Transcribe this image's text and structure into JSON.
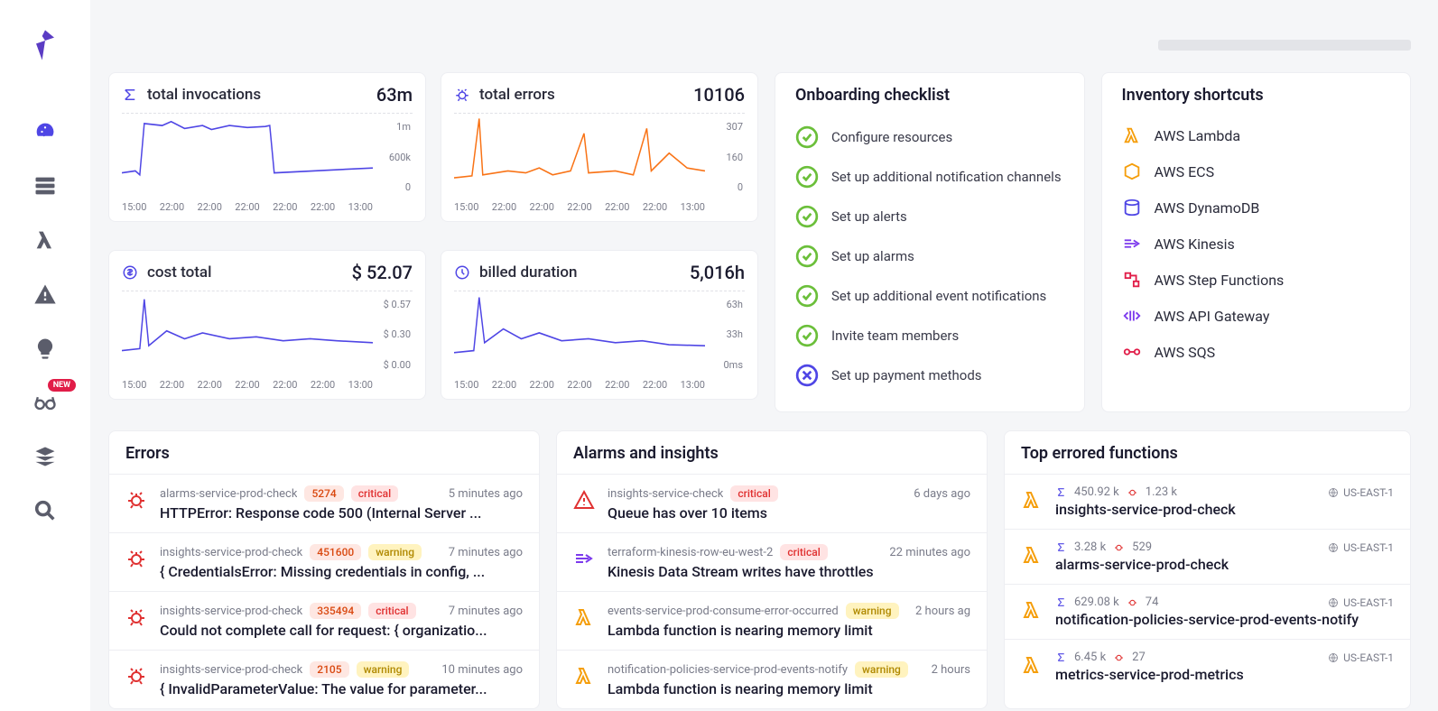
{
  "sidebar": {
    "badge_new": "NEW"
  },
  "metrics": [
    {
      "icon": "sigma",
      "title": "total invocations",
      "value": "63m",
      "ylabels": [
        "1m",
        "600k",
        "0"
      ],
      "xlabels": [
        "15:00",
        "22:00",
        "22:00",
        "22:00",
        "22:00",
        "22:00",
        "13:00"
      ],
      "color": "#4f46e5",
      "series": "inv"
    },
    {
      "icon": "bug",
      "title": "total errors",
      "value": "10106",
      "ylabels": [
        "307",
        "160",
        "0"
      ],
      "xlabels": [
        "15:00",
        "22:00",
        "22:00",
        "22:00",
        "22:00",
        "22:00",
        "13:00"
      ],
      "color": "#f97316",
      "series": "err"
    },
    {
      "icon": "dollar",
      "title": "cost total",
      "value": "$ 52.07",
      "ylabels": [
        "$ 0.57",
        "$ 0.30",
        "$ 0.00"
      ],
      "xlabels": [
        "15:00",
        "22:00",
        "22:00",
        "22:00",
        "22:00",
        "22:00",
        "13:00"
      ],
      "color": "#4f46e5",
      "series": "cost"
    },
    {
      "icon": "clock",
      "title": "billed duration",
      "value": "5,016h",
      "ylabels": [
        "63h",
        "33h",
        "0ms"
      ],
      "xlabels": [
        "15:00",
        "22:00",
        "22:00",
        "22:00",
        "22:00",
        "22:00",
        "13:00"
      ],
      "color": "#4f46e5",
      "series": "dur"
    }
  ],
  "chart_data": [
    {
      "type": "line",
      "title": "total invocations",
      "ylim": [
        0,
        1000000
      ],
      "ylabel": "",
      "xlabel": "",
      "categories": [
        "15:00",
        "22:00",
        "22:00",
        "22:00",
        "22:00",
        "22:00",
        "13:00"
      ],
      "values": [
        250000,
        950000,
        920000,
        930000,
        910000,
        300000,
        300000
      ]
    },
    {
      "type": "line",
      "title": "total errors",
      "ylim": [
        0,
        307
      ],
      "ylabel": "",
      "xlabel": "",
      "categories": [
        "15:00",
        "22:00",
        "22:00",
        "22:00",
        "22:00",
        "22:00",
        "13:00"
      ],
      "values": [
        40,
        300,
        60,
        55,
        58,
        210,
        70
      ]
    },
    {
      "type": "line",
      "title": "cost total",
      "ylim": [
        0,
        0.57
      ],
      "ylabel": "",
      "xlabel": "",
      "categories": [
        "15:00",
        "22:00",
        "22:00",
        "22:00",
        "22:00",
        "22:00",
        "13:00"
      ],
      "values": [
        0.17,
        0.55,
        0.33,
        0.32,
        0.3,
        0.3,
        0.28
      ]
    },
    {
      "type": "line",
      "title": "billed duration",
      "ylim": [
        0,
        63
      ],
      "ylabel": "",
      "xlabel": "",
      "categories": [
        "15:00",
        "22:00",
        "22:00",
        "22:00",
        "22:00",
        "22:00",
        "13:00"
      ],
      "values": [
        16,
        60,
        34,
        32,
        30,
        28,
        26
      ]
    }
  ],
  "checklist": {
    "title": "Onboarding checklist",
    "items": [
      {
        "label": "Configure resources",
        "done": true
      },
      {
        "label": "Set up additional notification channels",
        "done": true
      },
      {
        "label": "Set up alerts",
        "done": true
      },
      {
        "label": "Set up alarms",
        "done": true
      },
      {
        "label": "Set up additional event notifications",
        "done": true
      },
      {
        "label": "Invite team members",
        "done": true
      },
      {
        "label": "Set up payment methods",
        "done": false
      }
    ]
  },
  "inventory": {
    "title": "Inventory shortcuts",
    "items": [
      {
        "label": "AWS Lambda",
        "icon": "lambda"
      },
      {
        "label": "AWS ECS",
        "icon": "ecs"
      },
      {
        "label": "AWS DynamoDB",
        "icon": "dynamo"
      },
      {
        "label": "AWS Kinesis",
        "icon": "kinesis"
      },
      {
        "label": "AWS Step Functions",
        "icon": "step"
      },
      {
        "label": "AWS API Gateway",
        "icon": "api"
      },
      {
        "label": "AWS SQS",
        "icon": "sqs"
      }
    ]
  },
  "errors": {
    "title": "Errors",
    "rows": [
      {
        "src": "alarms-service-prod-check",
        "count": "5274",
        "sev": "critical",
        "time": "5 minutes ago",
        "title": "HTTPError: Response code 500 (Internal Server ..."
      },
      {
        "src": "insights-service-prod-check",
        "count": "451600",
        "sev": "warning",
        "time": "7 minutes ago",
        "title": "{ CredentialsError: Missing credentials in config, ..."
      },
      {
        "src": "insights-service-prod-check",
        "count": "335494",
        "sev": "critical",
        "time": "7 minutes ago",
        "title": "Could not complete call for request: { organizatio..."
      },
      {
        "src": "insights-service-prod-check",
        "count": "2105",
        "sev": "warning",
        "time": "10 minutes ago",
        "title": "{ InvalidParameterValue: The value for parameter..."
      }
    ]
  },
  "alarms": {
    "title": "Alarms and insights",
    "rows": [
      {
        "icon": "alert",
        "src": "insights-service-check",
        "sev": "critical",
        "time": "6 days ago",
        "title": "Queue has over 10 items"
      },
      {
        "icon": "kinesis",
        "src": "terraform-kinesis-row-eu-west-2",
        "sev": "critical",
        "time": "22 minutes ago",
        "title": "Kinesis Data Stream writes have throttles"
      },
      {
        "icon": "lambda",
        "src": "events-service-prod-consume-error-occurred",
        "sev": "warning",
        "time": "2 hours ag",
        "title": "Lambda function is nearing memory limit"
      },
      {
        "icon": "lambda",
        "src": "notification-policies-service-prod-events-notify",
        "sev": "warning",
        "time": "2 hours",
        "title": "Lambda function is nearing memory limit"
      }
    ]
  },
  "top_errored": {
    "title": "Top errored functions",
    "rows": [
      {
        "inv": "450.92 k",
        "err": "1.23 k",
        "region": "US-EAST-1",
        "name": "insights-service-prod-check"
      },
      {
        "inv": "3.28 k",
        "err": "529",
        "region": "US-EAST-1",
        "name": "alarms-service-prod-check"
      },
      {
        "inv": "629.08 k",
        "err": "74",
        "region": "US-EAST-1",
        "name": "notification-policies-service-prod-events-notify"
      },
      {
        "inv": "6.45 k",
        "err": "27",
        "region": "US-EAST-1",
        "name": "metrics-service-prod-metrics"
      }
    ]
  }
}
